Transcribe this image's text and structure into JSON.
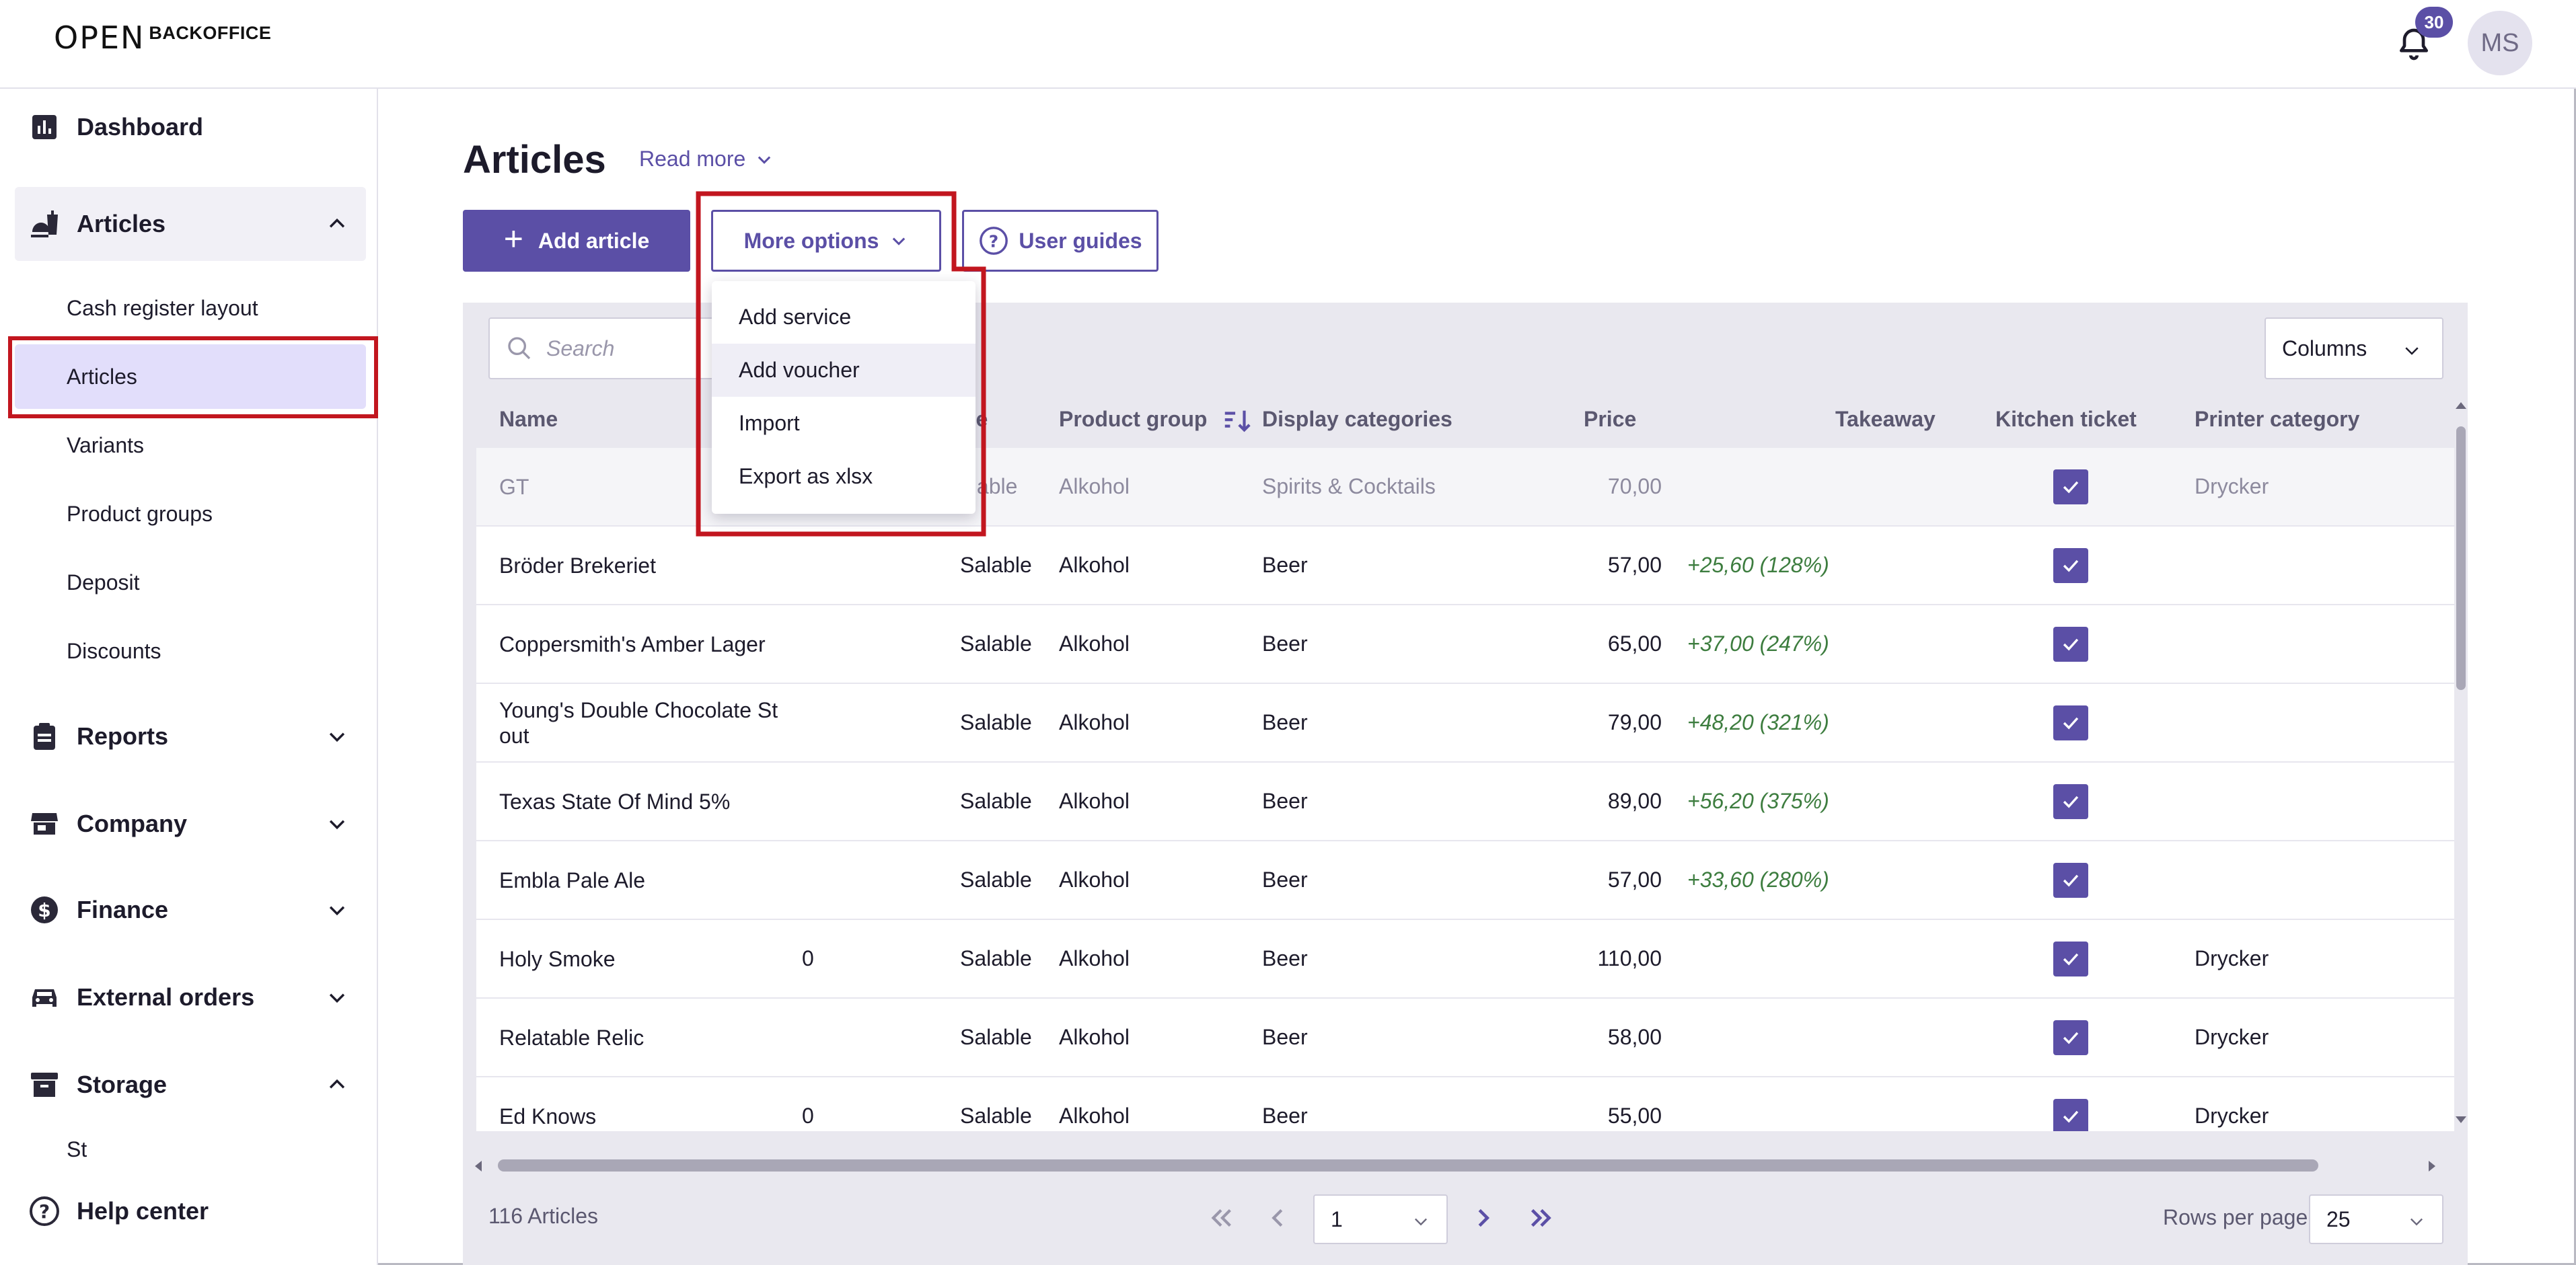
{
  "brand": {
    "mark": "OPEN",
    "product": "BACKOFFICE"
  },
  "header": {
    "notifications_count": "30",
    "avatar_initials": "MS"
  },
  "sidebar": {
    "dashboard": "Dashboard",
    "articles": "Articles",
    "articles_sub": [
      "Cash register layout",
      "Articles",
      "Variants",
      "Product groups",
      "Deposit",
      "Discounts"
    ],
    "reports": "Reports",
    "company": "Company",
    "finance": "Finance",
    "external_orders": "External orders",
    "storage": "Storage",
    "storage_partial": "St",
    "help": "Help center"
  },
  "main": {
    "title": "Articles",
    "read_more": "Read more",
    "add_article": "Add article",
    "more_options": "More options",
    "user_guides": "User guides",
    "search_placeholder": "Search",
    "columns": "Columns"
  },
  "dropdown": [
    "Add service",
    "Add voucher",
    "Import",
    "Export as xlsx"
  ],
  "table": {
    "headers": {
      "name": "Name",
      "type_partial": "pe",
      "product_group": "Product group",
      "display_categories": "Display categories",
      "price": "Price",
      "takeaway": "Takeaway",
      "kitchen_ticket": "Kitchen ticket",
      "printer_category": "Printer category"
    },
    "rows": [
      {
        "name": "GT",
        "qty": "",
        "type": "alable",
        "group": "Alkohol",
        "category": "Spirits & Cocktails",
        "price": "70,00",
        "margin": "",
        "kitchen": true,
        "printer": "Drycker"
      },
      {
        "name": "Bröder Brekeriet",
        "qty": "",
        "type": "Salable",
        "group": "Alkohol",
        "category": "Beer",
        "price": "57,00",
        "margin": "+25,60 (128%)",
        "kitchen": true,
        "printer": ""
      },
      {
        "name": "Coppersmith's Amber Lager",
        "qty": "",
        "type": "Salable",
        "group": "Alkohol",
        "category": "Beer",
        "price": "65,00",
        "margin": "+37,00 (247%)",
        "kitchen": true,
        "printer": ""
      },
      {
        "name": "Young's Double Chocolate St out",
        "qty": "",
        "type": "Salable",
        "group": "Alkohol",
        "category": "Beer",
        "price": "79,00",
        "margin": "+48,20 (321%)",
        "kitchen": true,
        "printer": ""
      },
      {
        "name": "Texas State Of Mind 5%",
        "qty": "",
        "type": "Salable",
        "group": "Alkohol",
        "category": "Beer",
        "price": "89,00",
        "margin": "+56,20 (375%)",
        "kitchen": true,
        "printer": ""
      },
      {
        "name": "Embla Pale Ale",
        "qty": "",
        "type": "Salable",
        "group": "Alkohol",
        "category": "Beer",
        "price": "57,00",
        "margin": "+33,60 (280%)",
        "kitchen": true,
        "printer": ""
      },
      {
        "name": "Holy Smoke",
        "qty": "0",
        "type": "Salable",
        "group": "Alkohol",
        "category": "Beer",
        "price": "110,00",
        "margin": "",
        "kitchen": true,
        "printer": "Drycker"
      },
      {
        "name": "Relatable Relic",
        "qty": "",
        "type": "Salable",
        "group": "Alkohol",
        "category": "Beer",
        "price": "58,00",
        "margin": "",
        "kitchen": true,
        "printer": "Drycker"
      },
      {
        "name": "Ed Knows",
        "qty": "0",
        "type": "Salable",
        "group": "Alkohol",
        "category": "Beer",
        "price": "55,00",
        "margin": "",
        "kitchen": true,
        "printer": "Drycker"
      }
    ]
  },
  "footer": {
    "count": "116 Articles",
    "page": "1",
    "rows_label": "Rows per page",
    "rows_value": "25"
  },
  "colors": {
    "accent": "#5b4fa6",
    "highlight": "#c2161f",
    "active_bg": "#e2defb",
    "positive": "#3d7d3f"
  }
}
